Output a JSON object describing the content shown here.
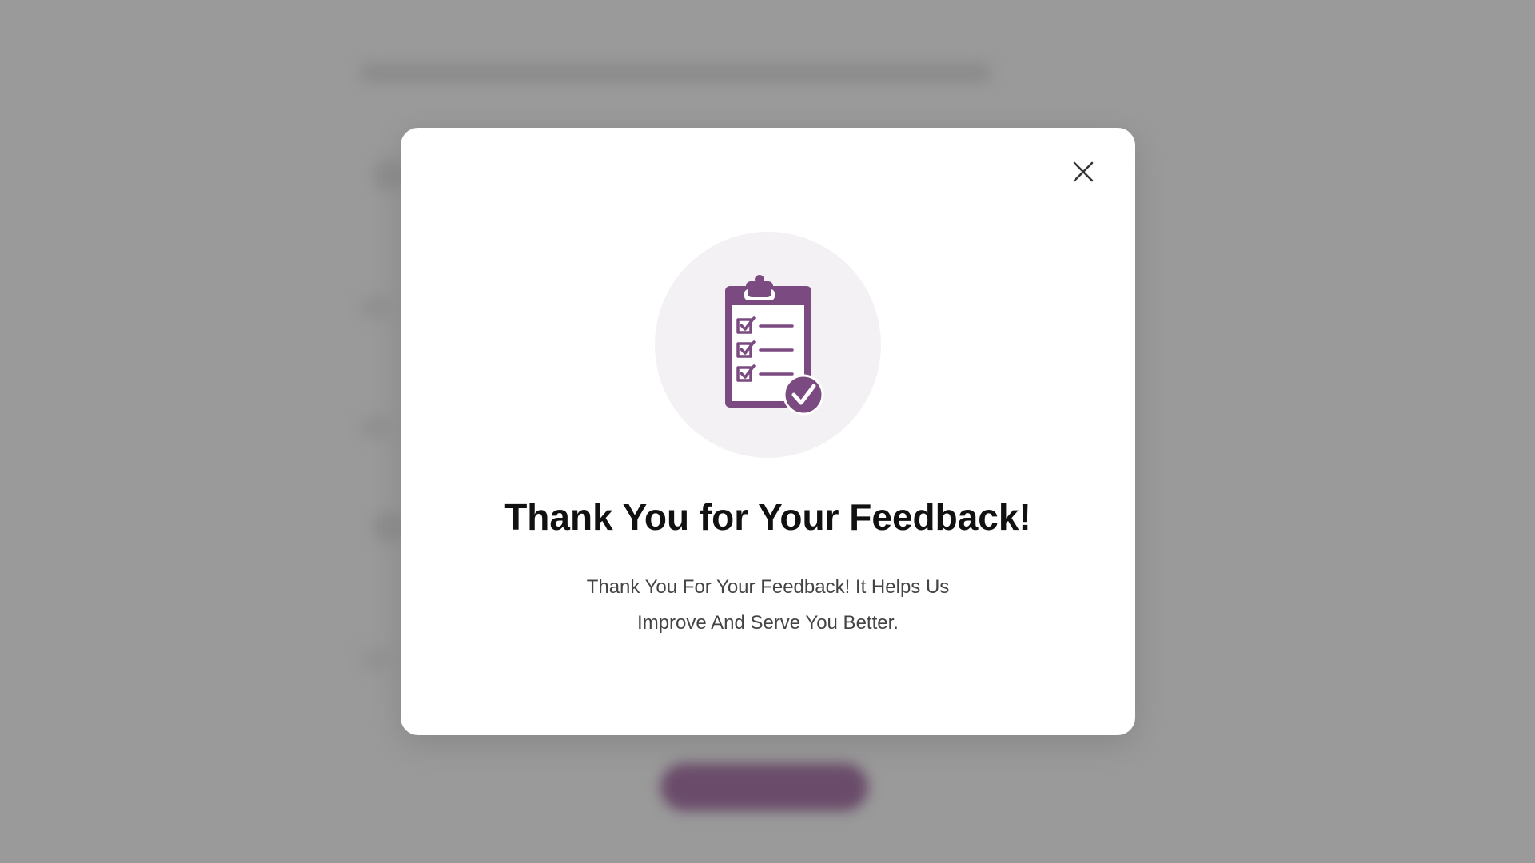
{
  "modal": {
    "title": "Thank You for Your Feedback!",
    "message": "Thank You For Your Feedback! It Helps Us Improve And Serve You Better.",
    "close_icon": "close-icon",
    "illustration_icon": "clipboard-check-icon"
  },
  "colors": {
    "accent": "#7a4a80",
    "overlay": "#9a9a9a",
    "icon_bg": "#f4f1f5",
    "title": "#111111",
    "message": "#444444"
  }
}
